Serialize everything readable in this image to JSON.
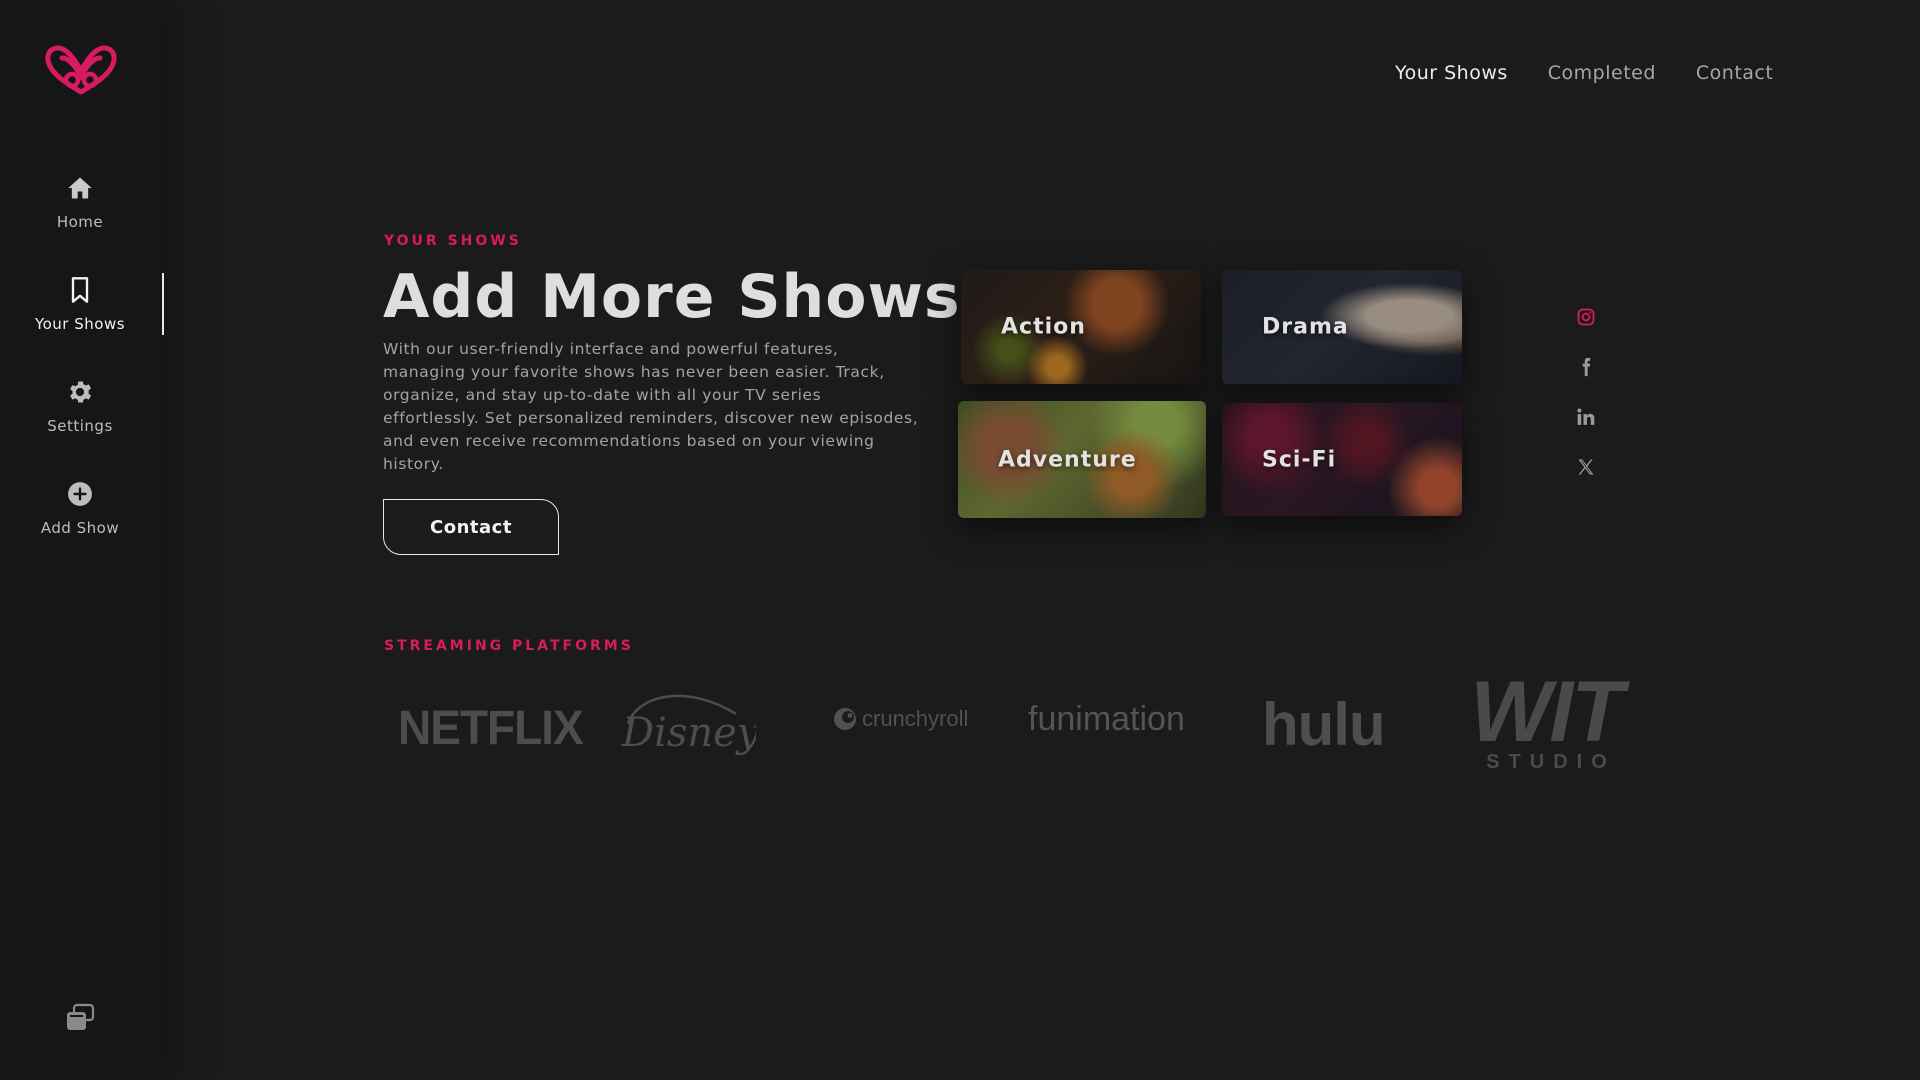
{
  "colors": {
    "accent": "#d81b60",
    "background": "#1b1b1c",
    "sidebar": "#161617"
  },
  "sidebar": {
    "logo_icon": "infinity-heart-logo",
    "items": [
      {
        "label": "Home",
        "icon": "home-icon"
      },
      {
        "label": "Your Shows",
        "icon": "bookmark-icon",
        "active": true
      },
      {
        "label": "Settings",
        "icon": "gear-icon"
      },
      {
        "label": "Add Show",
        "icon": "plus-circle-icon"
      }
    ],
    "bottom_icon": "windows-stack-icon"
  },
  "topnav": {
    "items": [
      {
        "label": "Your Shows",
        "active": true
      },
      {
        "label": "Completed"
      },
      {
        "label": "Contact"
      }
    ]
  },
  "hero": {
    "eyebrow": "YOUR SHOWS",
    "title": "Add More Shows",
    "description": "With our user-friendly interface and powerful features, managing your favorite shows has never been easier. Track, organize, and stay up-to-date with all your TV series effortlessly. Set personalized reminders, discover new episodes, and even receive recommendations based on your viewing history.",
    "button_label": "Contact"
  },
  "genres": [
    {
      "label": "Action"
    },
    {
      "label": "Drama"
    },
    {
      "label": "Adventure"
    },
    {
      "label": "Sci-Fi"
    }
  ],
  "social": [
    "instagram-icon",
    "facebook-icon",
    "linkedin-icon",
    "x-icon"
  ],
  "platforms": {
    "eyebrow": "STREAMING PLATFORMS",
    "items": [
      {
        "name": "NETFLIX"
      },
      {
        "name": "Disney+"
      },
      {
        "name": "crunchyroll"
      },
      {
        "name": "funimation"
      },
      {
        "name": "hulu"
      },
      {
        "name": "WIT",
        "sub": "STUDIO"
      }
    ]
  }
}
